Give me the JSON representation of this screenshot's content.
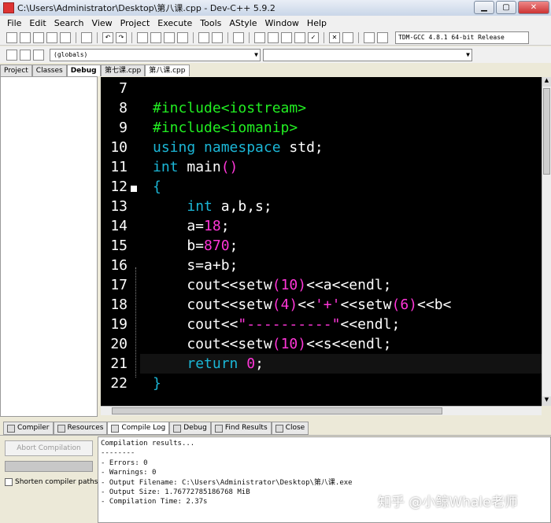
{
  "window": {
    "title": "C:\\Users\\Administrator\\Desktop\\第八课.cpp - Dev-C++ 5.9.2"
  },
  "menu": [
    "File",
    "Edit",
    "Search",
    "View",
    "Project",
    "Execute",
    "Tools",
    "AStyle",
    "Window",
    "Help"
  ],
  "toolbar": {
    "compiler": "TDM-GCC 4.8.1 64-bit Release",
    "scope": "(globals)"
  },
  "left_tabs": [
    "Project",
    "Classes",
    "Debug"
  ],
  "file_tabs": [
    "第七课.cpp",
    "第八课.cpp"
  ],
  "line_numbers": [
    "7",
    "8",
    "9",
    "10",
    "11",
    "12",
    "13",
    "14",
    "15",
    "16",
    "17",
    "18",
    "19",
    "20",
    "21",
    "22"
  ],
  "code_lines": [
    "",
    "#include<iostream>",
    "#include<iomanip>",
    "using namespace std;",
    "int main()",
    "{",
    "    int a,b,s;",
    "    a=18;",
    "    b=870;",
    "    s=a+b;",
    "    cout<<setw(10)<<a<<endl;",
    "    cout<<setw(4)<<'+'<<setw(6)<<b<",
    "    cout<<\"----------\"<<endl;",
    "    cout<<setw(10)<<s<<endl;",
    "    return 0;",
    "}"
  ],
  "bottom_tabs": [
    "Compiler",
    "Resources",
    "Compile Log",
    "Debug",
    "Find Results",
    "Close"
  ],
  "bottom": {
    "abort_button": "Abort Compilation",
    "shorten_label": "Shorten compiler paths"
  },
  "compile_log": [
    "Compilation results...",
    "--------",
    "- Errors: 0",
    "- Warnings: 0",
    "- Output Filename: C:\\Users\\Administrator\\Desktop\\第八课.exe",
    "- Output Size: 1.76772785186768 MiB",
    "- Compilation Time: 2.37s"
  ],
  "watermark": "知乎 @小鲸Whale老师",
  "colors": {
    "keyword": "#1bb6d6",
    "preprocessor": "#22ee22",
    "number": "#ff36d8",
    "editor_bg": "#000000"
  }
}
